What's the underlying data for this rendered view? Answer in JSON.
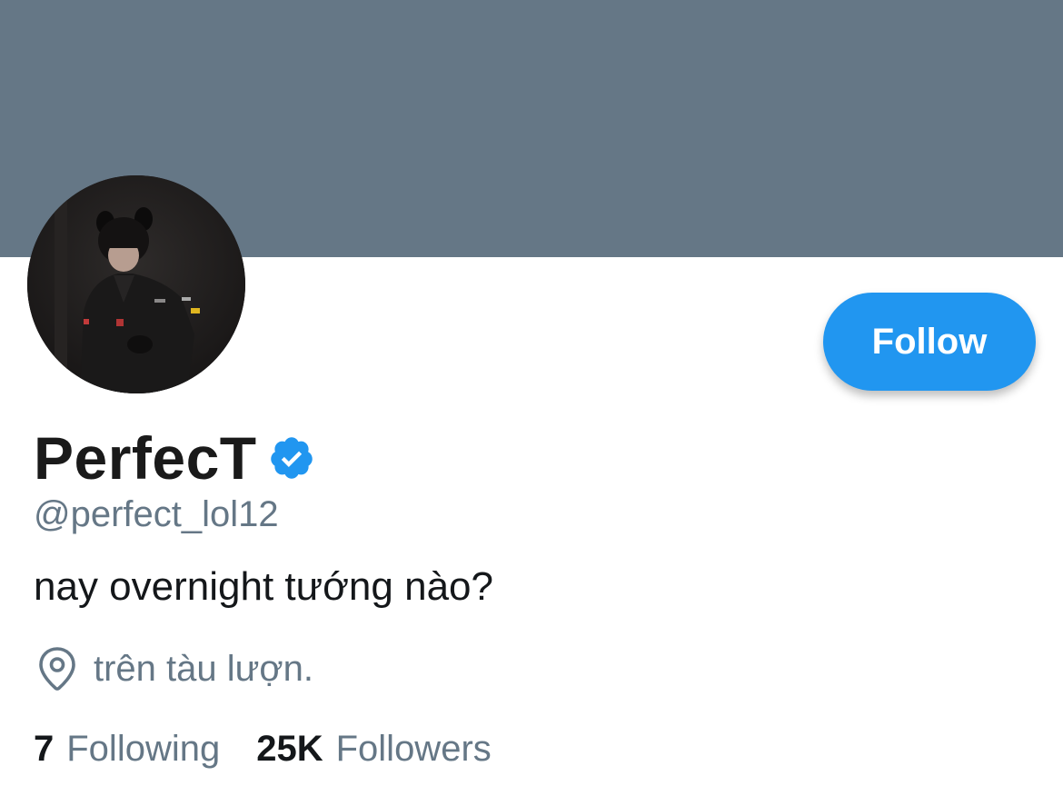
{
  "profile": {
    "banner_color": "#657786",
    "accent_color": "#2196f0",
    "display_name": "PerfecT",
    "verified_icon": "verified-badge-icon",
    "handle": "@perfect_lol12",
    "bio": "nay overnight tướng nào?",
    "location_icon": "location-pin-icon",
    "location": "trên tàu lượn.",
    "follow_label": "Follow"
  },
  "stats": {
    "following_count": "7",
    "following_label": "Following",
    "followers_count": "25K",
    "followers_label": "Followers"
  }
}
